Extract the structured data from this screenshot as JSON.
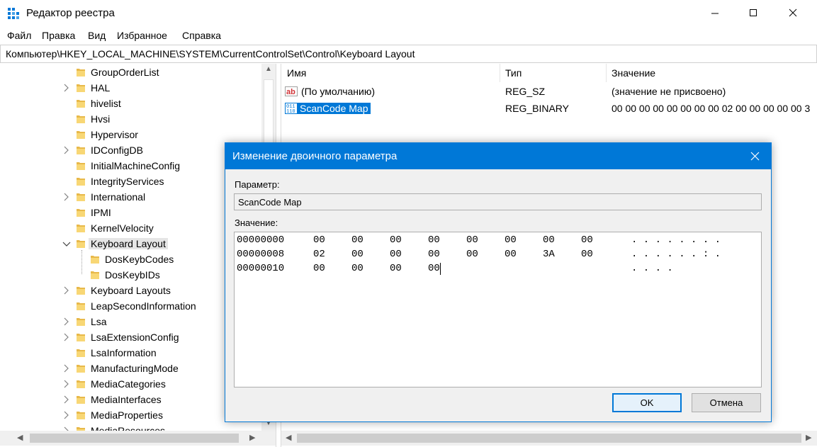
{
  "window": {
    "title": "Редактор реестра",
    "menu": [
      "Файл",
      "Правка",
      "Вид",
      "Избранное",
      "Справка"
    ],
    "address": "Компьютер\\HKEY_LOCAL_MACHINE\\SYSTEM\\CurrentControlSet\\Control\\Keyboard Layout"
  },
  "tree": {
    "items": [
      {
        "label": "GroupOrderList",
        "expander": "none"
      },
      {
        "label": "HAL",
        "expander": "collapsed"
      },
      {
        "label": "hivelist",
        "expander": "none"
      },
      {
        "label": "Hvsi",
        "expander": "none"
      },
      {
        "label": "Hypervisor",
        "expander": "none"
      },
      {
        "label": "IDConfigDB",
        "expander": "collapsed"
      },
      {
        "label": "InitialMachineConfig",
        "expander": "none"
      },
      {
        "label": "IntegrityServices",
        "expander": "none"
      },
      {
        "label": "International",
        "expander": "collapsed"
      },
      {
        "label": "IPMI",
        "expander": "none"
      },
      {
        "label": "KernelVelocity",
        "expander": "none"
      },
      {
        "label": "Keyboard Layout",
        "expander": "expanded",
        "selected": true
      },
      {
        "label": "DosKeybCodes",
        "expander": "none",
        "child": true
      },
      {
        "label": "DosKeybIDs",
        "expander": "none",
        "child": true
      },
      {
        "label": "Keyboard Layouts",
        "expander": "collapsed"
      },
      {
        "label": "LeapSecondInformation",
        "expander": "none"
      },
      {
        "label": "Lsa",
        "expander": "collapsed"
      },
      {
        "label": "LsaExtensionConfig",
        "expander": "collapsed"
      },
      {
        "label": "LsaInformation",
        "expander": "none"
      },
      {
        "label": "ManufacturingMode",
        "expander": "collapsed"
      },
      {
        "label": "MediaCategories",
        "expander": "collapsed"
      },
      {
        "label": "MediaInterfaces",
        "expander": "collapsed"
      },
      {
        "label": "MediaProperties",
        "expander": "collapsed"
      },
      {
        "label": "MediaResources",
        "expander": "collapsed"
      }
    ]
  },
  "values_pane": {
    "columns": [
      "Имя",
      "Тип",
      "Значение"
    ],
    "rows": [
      {
        "icon": "string-value-icon",
        "name": "(По умолчанию)",
        "type": "REG_SZ",
        "data": "(значение не присвоено)"
      },
      {
        "icon": "binary-value-icon",
        "name": "ScanCode Map",
        "type": "REG_BINARY",
        "data": "00 00 00 00 00 00 00 00 02 00 00 00 00 00 3",
        "selected": true
      }
    ]
  },
  "dialog": {
    "title": "Изменение двоичного параметра",
    "param_label": "Параметр:",
    "param_value": "ScanCode Map",
    "value_label": "Значение:",
    "hex_lines": [
      {
        "offset": "00000000",
        "bytes": [
          "00",
          "00",
          "00",
          "00",
          "00",
          "00",
          "00",
          "00"
        ],
        "ascii": ". . . . . . . ."
      },
      {
        "offset": "00000008",
        "bytes": [
          "02",
          "00",
          "00",
          "00",
          "00",
          "00",
          "3A",
          "00"
        ],
        "ascii": ". . . . . . : ."
      },
      {
        "offset": "00000010",
        "bytes": [
          "00",
          "00",
          "00",
          "00"
        ],
        "ascii": ". . . ."
      }
    ],
    "ok_label": "OK",
    "cancel_label": "Отмена"
  },
  "colors": {
    "accent": "#0078d7",
    "folder": "#e8b94a",
    "dialog_bg": "#f0f0f0"
  }
}
